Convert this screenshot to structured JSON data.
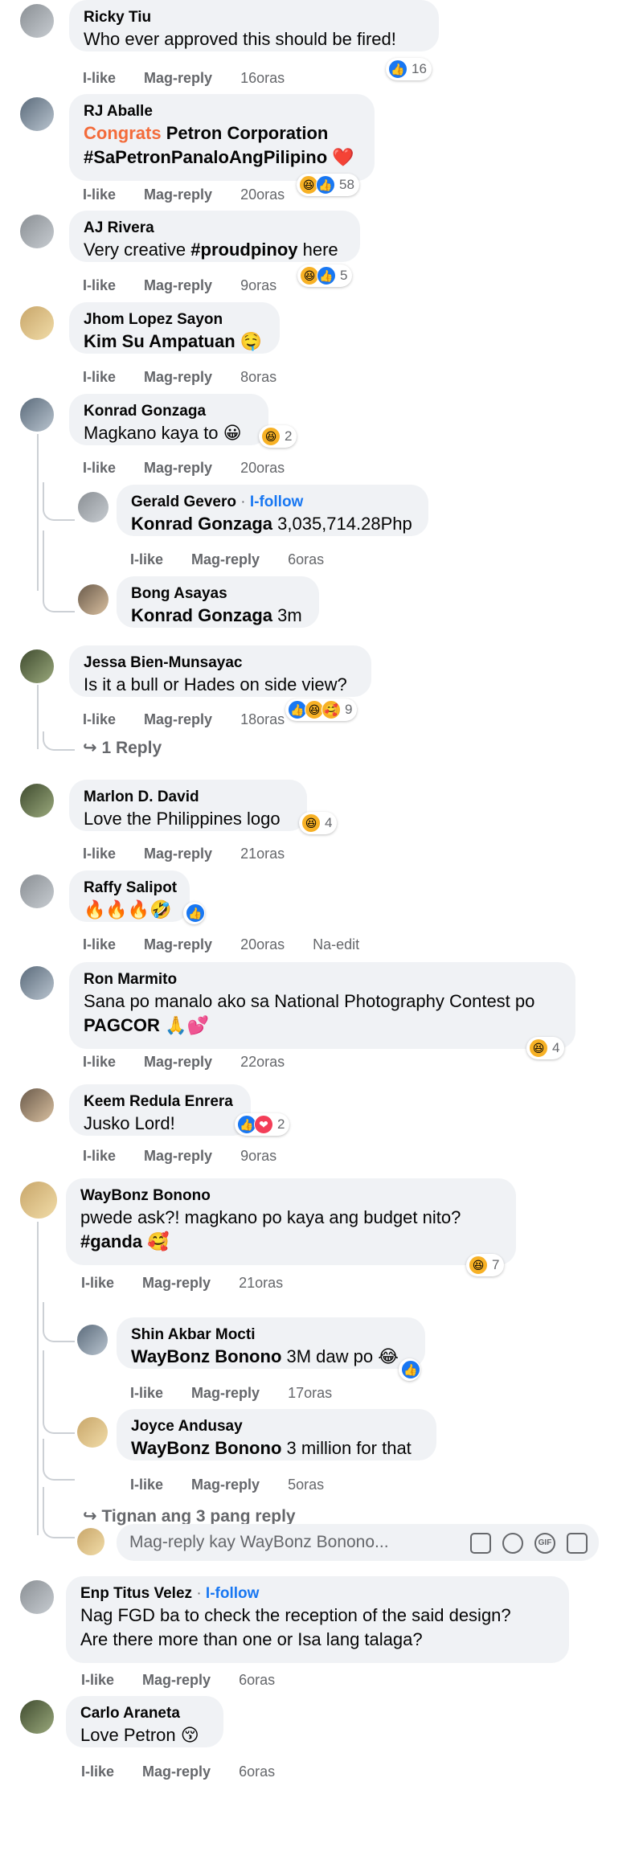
{
  "comments": [
    {
      "name": "Ricky Tiu",
      "text": "Who ever approved this should be fired!",
      "actions": [
        "I-like",
        "Mag-reply",
        "16oras"
      ],
      "reaction_count": "16",
      "reactions": [
        "like"
      ]
    },
    {
      "name": "RJ Aballe",
      "text_prefix": "Congrats",
      "text_rest": "Petron Corporation",
      "text_line2": "#SaPetronPanaloAngPilipino ❤️",
      "actions": [
        "I-like",
        "Mag-reply",
        "20oras"
      ],
      "reaction_count": "58",
      "reactions": [
        "haha",
        "like"
      ]
    },
    {
      "name": "AJ Rivera",
      "text_pre": "Very creative ",
      "text_tag": "#proudpinoy",
      "text_post": " here",
      "actions": [
        "I-like",
        "Mag-reply",
        "9oras"
      ],
      "reaction_count": "5",
      "reactions": [
        "haha",
        "like"
      ]
    },
    {
      "name": "Jhom Lopez Sayon",
      "text": "Kim Su Ampatuan 🤤",
      "actions": [
        "I-like",
        "Mag-reply",
        "8oras"
      ]
    },
    {
      "name": "Konrad Gonzaga",
      "text": "Magkano kaya to 😀",
      "actions": [
        "I-like",
        "Mag-reply",
        "20oras"
      ],
      "reaction_count": "2",
      "reactions": [
        "haha"
      ]
    },
    {
      "name": "Jessa Bien-Munsayac",
      "text": "Is it a bull or Hades on side view?",
      "actions": [
        "I-like",
        "Mag-reply",
        "18oras"
      ],
      "reaction_count": "9",
      "reactions": [
        "like",
        "haha",
        "care"
      ],
      "more_replies": "1 Reply"
    },
    {
      "name": "Marlon D. David",
      "text": "Love the Philippines logo",
      "actions": [
        "I-like",
        "Mag-reply",
        "21oras"
      ],
      "reaction_count": "4",
      "reactions": [
        "haha"
      ]
    },
    {
      "name": "Raffy Salipot",
      "text": "🔥🔥🔥🤣",
      "actions": [
        "I-like",
        "Mag-reply",
        "20oras",
        "Na-edit"
      ],
      "reactions": [
        "like"
      ]
    },
    {
      "name": "Ron Marmito",
      "text": "Sana po manalo ako sa National Photography Contest po",
      "text_line2_bold": "PAGCOR",
      "text_line2_emoji": " 🙏💕",
      "actions": [
        "I-like",
        "Mag-reply",
        "22oras"
      ],
      "reaction_count": "4",
      "reactions": [
        "haha"
      ]
    },
    {
      "name": "Keem Redula Enrera",
      "text": "Jusko Lord!",
      "actions": [
        "I-like",
        "Mag-reply",
        "9oras"
      ],
      "reaction_count": "2",
      "reactions": [
        "like",
        "heart"
      ]
    },
    {
      "name": "WayBonz Bonono",
      "text": "pwede ask?! magkano po kaya ang budget nito?",
      "text_line2": "#ganda 🥰",
      "actions": [
        "I-like",
        "Mag-reply",
        "21oras"
      ],
      "reaction_count": "7",
      "reactions": [
        "haha"
      ],
      "more_replies": "Tignan ang 3 pang reply",
      "reply_placeholder": "Mag-reply kay WayBonz Bonono..."
    },
    {
      "name": "Enp Titus Velez",
      "follow": "I-follow",
      "text": "Nag FGD ba to check the reception of the said design?",
      "text_line2": "Are there more than one or Isa lang talaga?",
      "actions": [
        "I-like",
        "Mag-reply",
        "6oras"
      ]
    },
    {
      "name": "Carlo Araneta",
      "text": "Love Petron 😚",
      "actions": [
        "I-like",
        "Mag-reply",
        "6oras"
      ]
    }
  ],
  "replies": [
    {
      "name": "Gerald Gevero",
      "follow": "I-follow",
      "mention": "Konrad Gonzaga",
      "text": " 3,035,714.28Php",
      "actions": [
        "I-like",
        "Mag-reply",
        "6oras"
      ]
    },
    {
      "name": "Bong Asayas",
      "mention": "Konrad Gonzaga",
      "text": " 3m"
    },
    {
      "name": "Shin Akbar Mocti",
      "mention": "WayBonz Bonono",
      "text": " 3M daw po 😂",
      "actions": [
        "I-like",
        "Mag-reply",
        "17oras"
      ],
      "reactions": [
        "like"
      ]
    },
    {
      "name": "Joyce Andusay",
      "mention": "WayBonz Bonono",
      "text": " 3 million for that",
      "actions": [
        "I-like",
        "Mag-reply",
        "5oras"
      ]
    }
  ],
  "separator_dot": "·",
  "icons": {
    "like": "👍",
    "haha": "😆",
    "heart": "❤",
    "care": "🥰",
    "reply_arrow": "↪",
    "sticker": "sticker-icon",
    "emoji": "emoji-icon",
    "gif": "GIF",
    "camera": "camera-icon"
  }
}
